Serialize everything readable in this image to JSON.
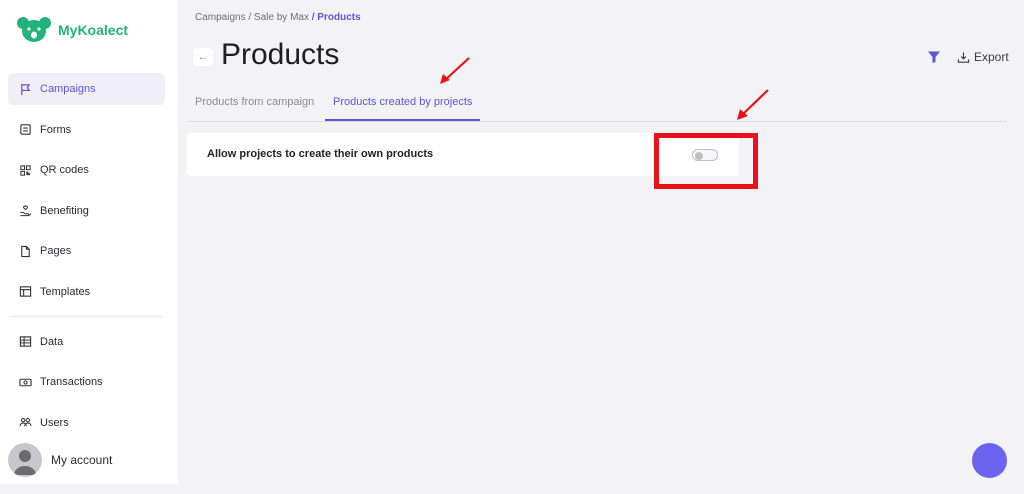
{
  "brand": {
    "name": "MyKoalect",
    "color": "#22b27a"
  },
  "sidebar": {
    "items": [
      {
        "label": "Campaigns",
        "icon": "flag-icon",
        "active": true
      },
      {
        "label": "Forms",
        "icon": "form-icon"
      },
      {
        "label": "QR codes",
        "icon": "qr-code-icon"
      },
      {
        "label": "Benefiting",
        "icon": "hand-heart-icon"
      },
      {
        "label": "Pages",
        "icon": "page-icon"
      },
      {
        "label": "Templates",
        "icon": "template-icon"
      },
      {
        "label": "Data",
        "icon": "table-icon"
      },
      {
        "label": "Transactions",
        "icon": "money-icon"
      },
      {
        "label": "Users",
        "icon": "users-icon"
      }
    ],
    "account_label": "My account"
  },
  "breadcrumb": {
    "part1": "Campaigns",
    "part2": "/ Sale by Max",
    "current": "/ Products"
  },
  "header": {
    "title": "Products",
    "export_label": "Export"
  },
  "tabs": [
    {
      "label": "Products from campaign",
      "active": false
    },
    {
      "label": "Products created by projects",
      "active": true
    }
  ],
  "setting": {
    "label": "Allow projects to create their own products",
    "enabled": false
  },
  "colors": {
    "accent": "#5b55d6",
    "fab": "#6c63f0",
    "annotation": "#e8131a"
  }
}
